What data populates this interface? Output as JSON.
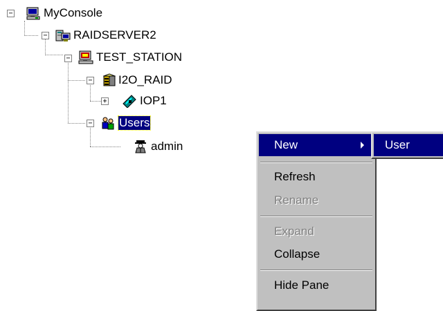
{
  "tree": {
    "root": "MyConsole",
    "server": "RAIDSERVER2",
    "station": "TEST_STATION",
    "raid": "I2O_RAID",
    "iop": "IOP1",
    "users": "Users",
    "admin": "admin"
  },
  "icons": {
    "console": "computer-console-icon",
    "server": "server-icon",
    "station": "workstation-icon",
    "raid": "raid-controller-icon",
    "iop": "io-processor-icon",
    "users": "users-group-icon",
    "admin": "user-admin-icon"
  },
  "context_menu": {
    "new": "New",
    "refresh": "Refresh",
    "rename": "Rename",
    "expand": "Expand",
    "collapse": "Collapse",
    "hide_pane": "Hide Pane"
  },
  "submenu": {
    "user": "User"
  },
  "colors": {
    "highlight": "#000080",
    "menu_face": "#c0c0c0",
    "disabled_text": "#808080"
  }
}
